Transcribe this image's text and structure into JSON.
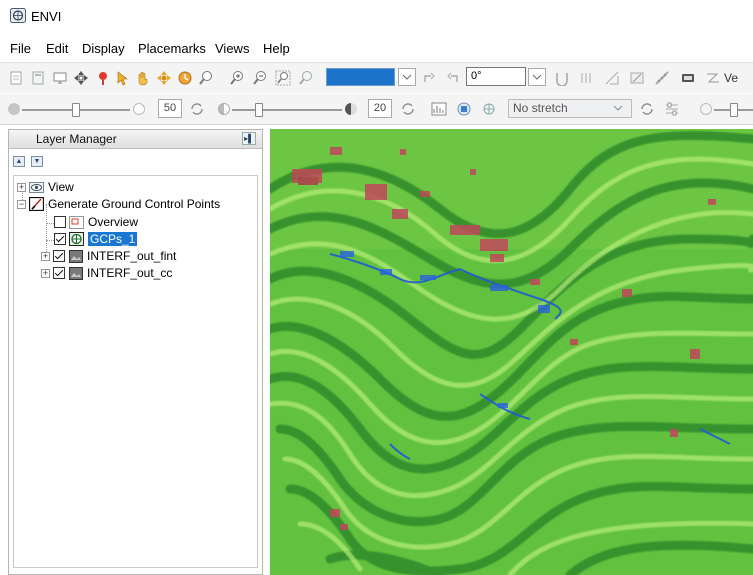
{
  "window": {
    "title": "ENVI"
  },
  "menu": [
    "File",
    "Edit",
    "Display",
    "Placemarks",
    "Views",
    "Help"
  ],
  "toolbar1": {
    "zoom_value": "",
    "rotation_value": "0°",
    "trailing_label": "Ve"
  },
  "toolbar2": {
    "brightness_value": "50",
    "transparency_value": "20",
    "stretch_value": "No stretch"
  },
  "layer_manager": {
    "title": "Layer Manager",
    "tree": {
      "view": "View",
      "group": "Generate Ground Control Points",
      "overview": "Overview",
      "gcps": "GCPs_1",
      "fint": "INTERF_out_fint",
      "cc": "INTERF_out_cc"
    }
  },
  "colors": {
    "selection": "#1976d2",
    "zoom_field": "#1c73c9",
    "fringe_green": "#5fbe3b",
    "fringe_dark": "#2e8b2c",
    "coherence_red": "#c0475a",
    "fringe_blue": "#1f5bd6"
  }
}
